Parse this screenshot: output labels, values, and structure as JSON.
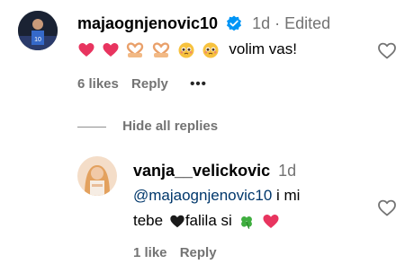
{
  "comment": {
    "username": "majaognjenovic10",
    "time": "1d",
    "separator": "·",
    "edited": "Edited",
    "text": "volim vas!",
    "likes": "6 likes",
    "reply": "Reply",
    "more": "•••"
  },
  "replies_toggle": "Hide all replies",
  "reply_comment": {
    "username": "vanja__velickovic",
    "time": "1d",
    "mention": "@majaognjenovic10",
    "text1": " i mi",
    "text2": "tebe",
    "text3": "falila si",
    "likes": "1 like",
    "reply": "Reply"
  },
  "colors": {
    "verified": "#0095f6",
    "link": "#00376b",
    "meta": "#737373"
  },
  "icons": [
    "heart-emoji",
    "heart-hands-emoji",
    "pleading-face-emoji",
    "black-heart-emoji",
    "four-leaf-clover-emoji",
    "like-heart-icon",
    "verified-badge-icon"
  ]
}
